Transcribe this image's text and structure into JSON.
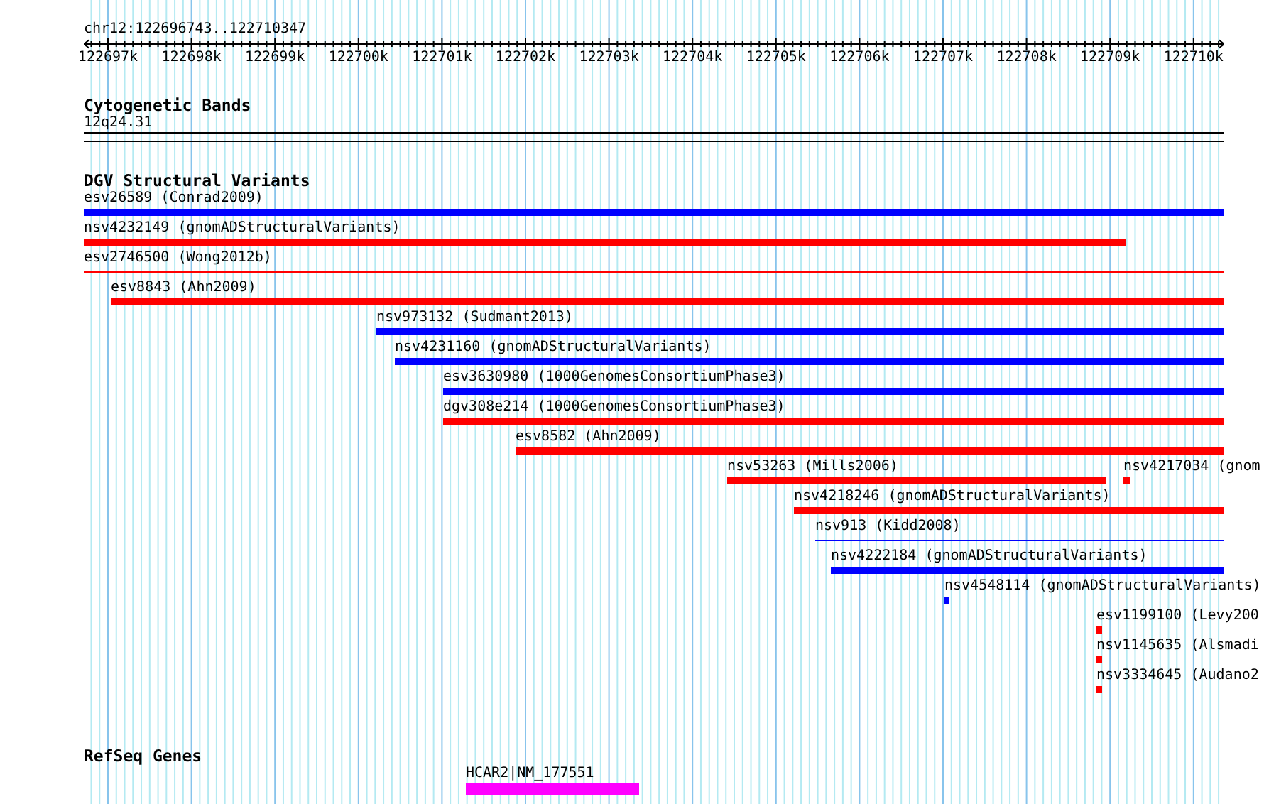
{
  "ruler": {
    "title": "chr12:122696743..122710347",
    "tick_labels": [
      "122697k",
      "122698k",
      "122699k",
      "122700k",
      "122701k",
      "122702k",
      "122703k",
      "122704k",
      "122705k",
      "122706k",
      "122707k",
      "122708k",
      "122709k",
      "122710k"
    ]
  },
  "cytogenetic_bands": {
    "title": "Cytogenetic Bands",
    "band": "12q24.31"
  },
  "dgv": {
    "title": "DGV Structural Variants",
    "rows": [
      {
        "features": [
          {
            "label": "esv26589 (Conrad2009)",
            "color": "#0000ff",
            "kind": "bar"
          }
        ]
      },
      {
        "features": [
          {
            "label": "nsv4232149 (gnomADStructuralVariants)",
            "color": "#ff0000",
            "kind": "bar"
          }
        ]
      },
      {
        "features": [
          {
            "label": "esv2746500 (Wong2012b)",
            "color": "#ff0000",
            "kind": "line"
          }
        ]
      },
      {
        "features": [
          {
            "label": "esv8843 (Ahn2009)",
            "color": "#ff0000",
            "kind": "bar"
          }
        ]
      },
      {
        "features": [
          {
            "label": "nsv973132 (Sudmant2013)",
            "color": "#0000ff",
            "kind": "bar"
          }
        ]
      },
      {
        "features": [
          {
            "label": "nsv4231160 (gnomADStructuralVariants)",
            "color": "#0000ff",
            "kind": "bar"
          }
        ]
      },
      {
        "features": [
          {
            "label": "esv3630980 (1000GenomesConsortiumPhase3)",
            "color": "#0000ff",
            "kind": "bar"
          }
        ]
      },
      {
        "features": [
          {
            "label": "dgv308e214 (1000GenomesConsortiumPhase3)",
            "color": "#ff0000",
            "kind": "bar"
          }
        ]
      },
      {
        "features": [
          {
            "label": "esv8582 (Ahn2009)",
            "color": "#ff0000",
            "kind": "bar"
          }
        ]
      },
      {
        "features": [
          {
            "label": "nsv53263 (Mills2006)",
            "color": "#ff0000",
            "kind": "bar"
          },
          {
            "label": "nsv4217034 (gnom",
            "color": "#ff0000",
            "kind": "bar"
          }
        ]
      },
      {
        "features": [
          {
            "label": "nsv4218246 (gnomADStructuralVariants)",
            "color": "#ff0000",
            "kind": "bar"
          }
        ]
      },
      {
        "features": [
          {
            "label": "nsv913 (Kidd2008)",
            "color": "#0000ff",
            "kind": "line"
          }
        ]
      },
      {
        "features": [
          {
            "label": "nsv4222184 (gnomADStructuralVariants)",
            "color": "#0000ff",
            "kind": "bar"
          }
        ]
      },
      {
        "features": [
          {
            "label": "nsv4548114 (gnomADStructuralVariants)",
            "color": "#0000ff",
            "kind": "bar"
          }
        ]
      },
      {
        "features": [
          {
            "label": "esv1199100 (Levy200",
            "color": "#ff0000",
            "kind": "bar"
          }
        ]
      },
      {
        "features": [
          {
            "label": "nsv1145635 (Alsmadi",
            "color": "#ff0000",
            "kind": "bar"
          }
        ]
      },
      {
        "features": [
          {
            "label": "nsv3334645 (Audano2",
            "color": "#ff0000",
            "kind": "bar"
          }
        ]
      }
    ]
  },
  "refseq": {
    "title": "RefSeq Genes",
    "genes": [
      {
        "label": "HCAR2|NM_177551"
      }
    ]
  }
}
